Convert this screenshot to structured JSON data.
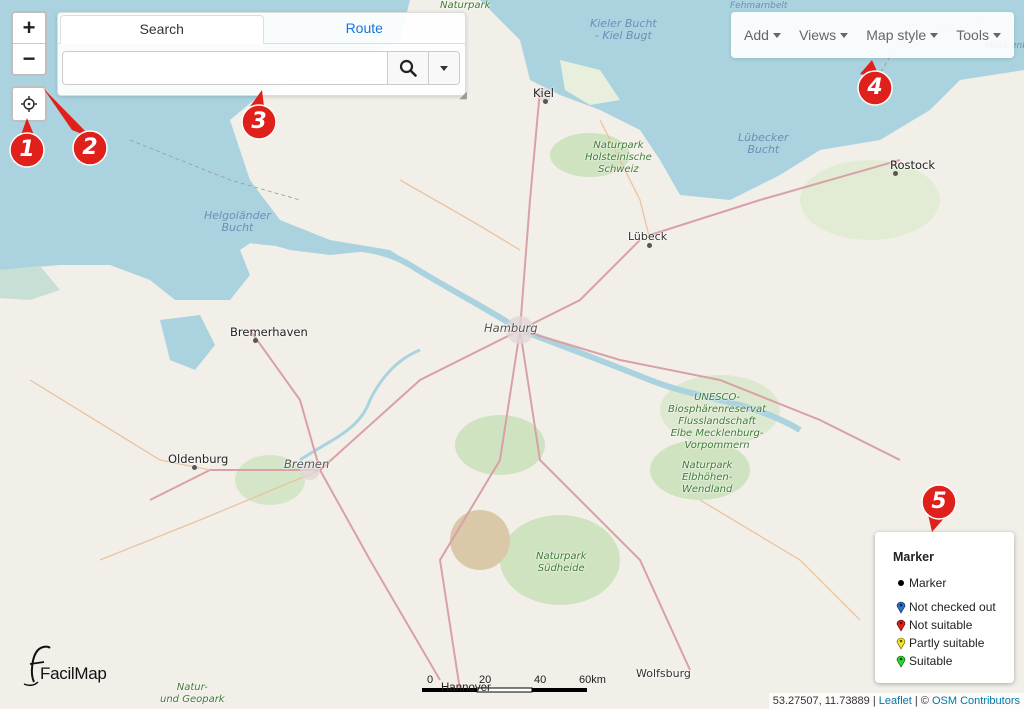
{
  "controls": {
    "zoom_in": "+",
    "zoom_out": "−",
    "locate_icon": "crosshair-icon"
  },
  "search": {
    "tabs": [
      "Search",
      "Route"
    ],
    "active_tab": "Search",
    "value": "",
    "button_icon": "search-icon"
  },
  "menu": {
    "items": [
      "Add",
      "Views",
      "Map style",
      "Tools"
    ]
  },
  "map_labels": {
    "kiel": "Kiel",
    "kieler_bucht": "Kieler Bucht",
    "kiel_bugt": "- Kiel Bugt",
    "luebecker_bucht": "Lübecker",
    "luebecker_bucht2": "Bucht",
    "holsteinische": "Naturpark",
    "holsteinische2": "Holsteinische",
    "holsteinische3": "Schweiz",
    "rostock": "Rostock",
    "helgolander": "Helgoländer",
    "helgolander2": "Bucht",
    "luebeck": "Lübeck",
    "bremerhaven": "Bremerhaven",
    "hamburg": "Hamburg",
    "unesco1": "UNESCO-",
    "unesco2": "Biosphärenreservat",
    "unesco3": "Flusslandschaft",
    "unesco4": "Elbe Mecklenburg-",
    "unesco5": "Vorpommern",
    "elbhoehen1": "Naturpark",
    "elbhoehen2": "Elbhöhen-",
    "elbhoehen3": "Wendland",
    "oldenburg": "Oldenburg",
    "bremen": "Bremen",
    "suedheide1": "Naturpark",
    "suedheide2": "Südheide",
    "wolfsburg": "Wolfsburg",
    "hannover": "Hannover",
    "geopark1": "Natur-",
    "geopark2": "und Geopark",
    "naturpark_top": "Naturpark",
    "fehmarn": "Fehmarnbelt",
    "top_right": "Mecklenbu..."
  },
  "legend": {
    "title": "Marker",
    "entries": [
      {
        "label": "Marker",
        "color": "#000000",
        "shape": "dot"
      },
      {
        "label": "Not checked out",
        "color": "#2b6fd6",
        "shape": "pin"
      },
      {
        "label": "Not suitable",
        "color": "#e0201b",
        "shape": "pin"
      },
      {
        "label": "Partly suitable",
        "color": "#f2e524",
        "shape": "pin"
      },
      {
        "label": "Suitable",
        "color": "#2ed62e",
        "shape": "pin"
      }
    ]
  },
  "badges": [
    "1",
    "2",
    "3",
    "4",
    "5"
  ],
  "scale": {
    "ticks": [
      "0",
      "20",
      "40",
      "60km"
    ]
  },
  "attribution": {
    "coords": "53.27507, 11.73889",
    "leaflet": "Leaflet",
    "osm": "OSM Contributors",
    "copyright": "©"
  },
  "logo": {
    "text": "FacilMap"
  },
  "colors": {
    "water": "#aad3df",
    "land": "#f2efe9",
    "forest": "#add19e",
    "road_primary": "#d9a0a8",
    "badge": "#e0201b"
  }
}
